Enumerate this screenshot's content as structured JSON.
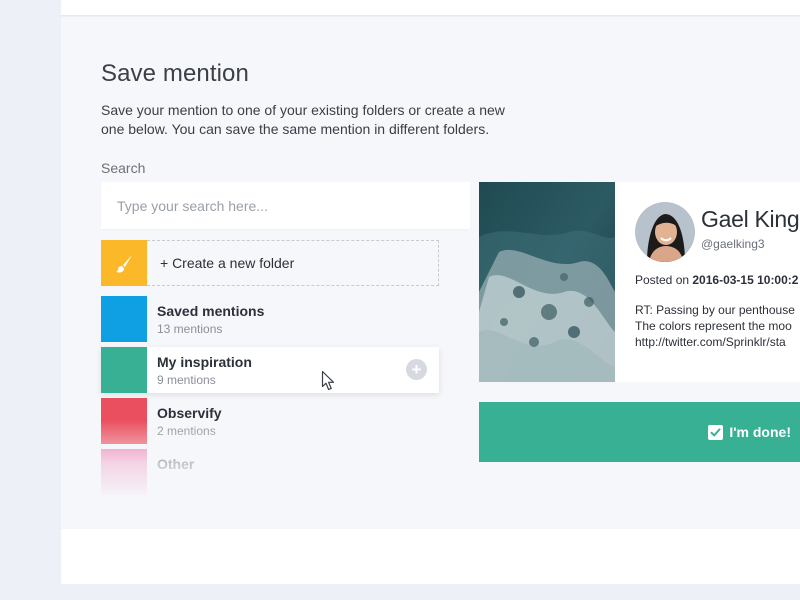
{
  "dialog": {
    "title": "Save mention",
    "description": "Save your mention to one of your existing folders or create a new one below. You can save the same mention in different folders."
  },
  "search": {
    "label": "Search",
    "placeholder": "Type your search here..."
  },
  "create_folder": {
    "label": "+ Create a new folder",
    "icon": "paintbrush-icon",
    "color": "#fbb92a"
  },
  "folders": [
    {
      "name": "Saved mentions",
      "count": "13 mentions",
      "color": "#0ea0e2"
    },
    {
      "name": "My inspiration",
      "count": "9 mentions",
      "color": "#37b093"
    },
    {
      "name": "Observify",
      "count": "2 mentions",
      "color": "#ea4f5f"
    },
    {
      "name": "Other",
      "count": "",
      "color": "#ee6fa7"
    }
  ],
  "mention": {
    "author": "Gael King",
    "handle": "@gaelking3",
    "posted_prefix": "Posted on ",
    "posted_date": "2016-03-15 10:00:2",
    "text_lines": [
      "RT: Passing by our penthouse",
      "The colors represent the moo",
      "http://twitter.com/Sprinklr/sta"
    ]
  },
  "done_button": {
    "label": "I'm done!",
    "color": "#37b093"
  }
}
